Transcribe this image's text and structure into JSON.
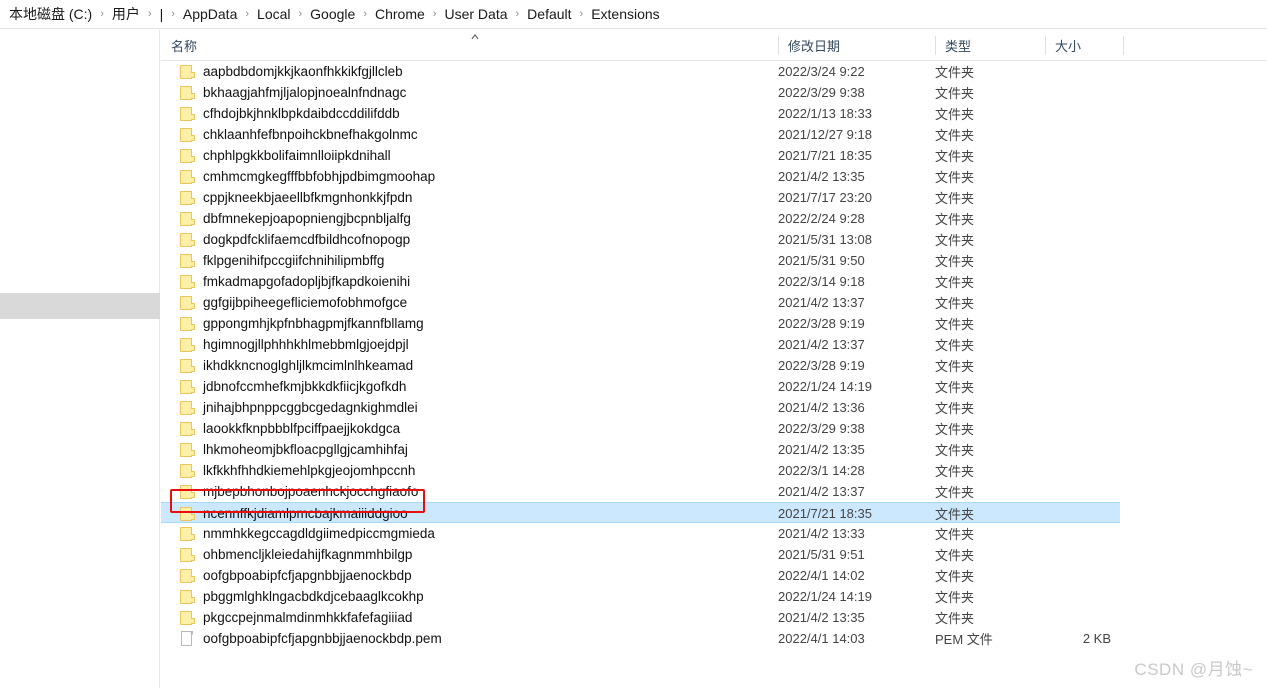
{
  "window": {
    "breadcrumb": {
      "separator": "›",
      "items": [
        "本地磁盘 (C:)",
        "用户",
        "|",
        "AppData",
        "Local",
        "Google",
        "Chrome",
        "User Data",
        "Default",
        "Extensions"
      ]
    }
  },
  "columns": {
    "name": "名称",
    "date_modified": "修改日期",
    "type": "类型",
    "size": "大小",
    "sort_caret": "sort-ascending-caret"
  },
  "types": {
    "folder": "文件夹",
    "pem": "PEM 文件"
  },
  "selection": {
    "selected_row_index": 21,
    "highlight_color": "#cce8ff",
    "annotation_color": "#e8100f"
  },
  "rows": [
    {
      "name": "aapbdbdomjkkjkaonfhkkikfgjllcleb",
      "date": "2022/3/24 9:22",
      "type": "文件夹",
      "size": "",
      "icon": "folder-icon"
    },
    {
      "name": "bkhaagjahfmjljalopjnoealnfndnagc",
      "date": "2022/3/29 9:38",
      "type": "文件夹",
      "size": "",
      "icon": "folder-icon"
    },
    {
      "name": "cfhdojbkjhnklbpkdaibdccddilifddb",
      "date": "2022/1/13 18:33",
      "type": "文件夹",
      "size": "",
      "icon": "folder-icon"
    },
    {
      "name": "chklaanhfefbnpoihckbnefhakgolnmc",
      "date": "2021/12/27 9:18",
      "type": "文件夹",
      "size": "",
      "icon": "folder-icon"
    },
    {
      "name": "chphlpgkkbolifaimnlloiipkdnihall",
      "date": "2021/7/21 18:35",
      "type": "文件夹",
      "size": "",
      "icon": "folder-icon"
    },
    {
      "name": "cmhmcmgkegfffbbfobhjpdbimgmoohap",
      "date": "2021/4/2 13:35",
      "type": "文件夹",
      "size": "",
      "icon": "folder-icon"
    },
    {
      "name": "cppjkneekbjaeellbfkmgnhonkkjfpdn",
      "date": "2021/7/17 23:20",
      "type": "文件夹",
      "size": "",
      "icon": "folder-icon"
    },
    {
      "name": "dbfmnekepjoapopniengjbcpnbljalfg",
      "date": "2022/2/24 9:28",
      "type": "文件夹",
      "size": "",
      "icon": "folder-icon"
    },
    {
      "name": "dogkpdfcklifaemcdfbildhcofnopogp",
      "date": "2021/5/31 13:08",
      "type": "文件夹",
      "size": "",
      "icon": "folder-icon"
    },
    {
      "name": "fklpgenihifpccgiifchnihilipmbffg",
      "date": "2021/5/31 9:50",
      "type": "文件夹",
      "size": "",
      "icon": "folder-icon"
    },
    {
      "name": "fmkadmapgofadopljbjfkapdkoienihi",
      "date": "2022/3/14 9:18",
      "type": "文件夹",
      "size": "",
      "icon": "folder-icon"
    },
    {
      "name": "ggfgijbpiheegefliciemofobhmofgce",
      "date": "2021/4/2 13:37",
      "type": "文件夹",
      "size": "",
      "icon": "folder-icon"
    },
    {
      "name": "gppongmhjkpfnbhagpmjfkannfbllamg",
      "date": "2022/3/28 9:19",
      "type": "文件夹",
      "size": "",
      "icon": "folder-icon"
    },
    {
      "name": "hgimnogjllphhhkhlmebbmlgjoejdpjl",
      "date": "2021/4/2 13:37",
      "type": "文件夹",
      "size": "",
      "icon": "folder-icon"
    },
    {
      "name": "ikhdkkncnoglghljlkmcimlnlhkeamad",
      "date": "2022/3/28 9:19",
      "type": "文件夹",
      "size": "",
      "icon": "folder-icon"
    },
    {
      "name": "jdbnofccmhefkmjbkkdkfiicjkgofkdh",
      "date": "2022/1/24 14:19",
      "type": "文件夹",
      "size": "",
      "icon": "folder-icon"
    },
    {
      "name": "jnihajbhpnppcggbcgedagnkighmdlei",
      "date": "2021/4/2 13:36",
      "type": "文件夹",
      "size": "",
      "icon": "folder-icon"
    },
    {
      "name": "laookkfknpbbblfpciffpaejjkokdgca",
      "date": "2022/3/29 9:38",
      "type": "文件夹",
      "size": "",
      "icon": "folder-icon"
    },
    {
      "name": "lhkmoheomjbkfloacpgllgjcamhihfaj",
      "date": "2021/4/2 13:35",
      "type": "文件夹",
      "size": "",
      "icon": "folder-icon"
    },
    {
      "name": "lkfkkhfhhdkiemehlpkgjeojomhpccnh",
      "date": "2022/3/1 14:28",
      "type": "文件夹",
      "size": "",
      "icon": "folder-icon"
    },
    {
      "name": "mjbepbhonbojpoaenhckjocchgfiaofo",
      "date": "2021/4/2 13:37",
      "type": "文件夹",
      "size": "",
      "icon": "folder-icon"
    },
    {
      "name": "ncennffkjdiamlpmcbajkmaiiiddgioo",
      "date": "2021/7/21 18:35",
      "type": "文件夹",
      "size": "",
      "icon": "folder-icon"
    },
    {
      "name": "nmmhkkegccagdldgiimedpiccmgmieda",
      "date": "2021/4/2 13:33",
      "type": "文件夹",
      "size": "",
      "icon": "folder-icon"
    },
    {
      "name": "ohbmencljkleiedahijfkagnmmhbilgp",
      "date": "2021/5/31 9:51",
      "type": "文件夹",
      "size": "",
      "icon": "folder-icon"
    },
    {
      "name": "oofgbpoabipfcfjapgnbbjjaenockbdp",
      "date": "2022/4/1 14:02",
      "type": "文件夹",
      "size": "",
      "icon": "folder-icon"
    },
    {
      "name": "pbggmlghklngacbdkdjcebaaglkcokhp",
      "date": "2022/1/24 14:19",
      "type": "文件夹",
      "size": "",
      "icon": "folder-icon"
    },
    {
      "name": "pkgccpejnmalmdinmhkkfafefagiiiad",
      "date": "2021/4/2 13:35",
      "type": "文件夹",
      "size": "",
      "icon": "folder-icon"
    },
    {
      "name": "oofgbpoabipfcfjapgnbbjjaenockbdp.pem",
      "date": "2022/4/1 14:03",
      "type": "PEM 文件",
      "size": "2 KB",
      "icon": "file-icon"
    }
  ],
  "watermark": "CSDN @月蚀~"
}
